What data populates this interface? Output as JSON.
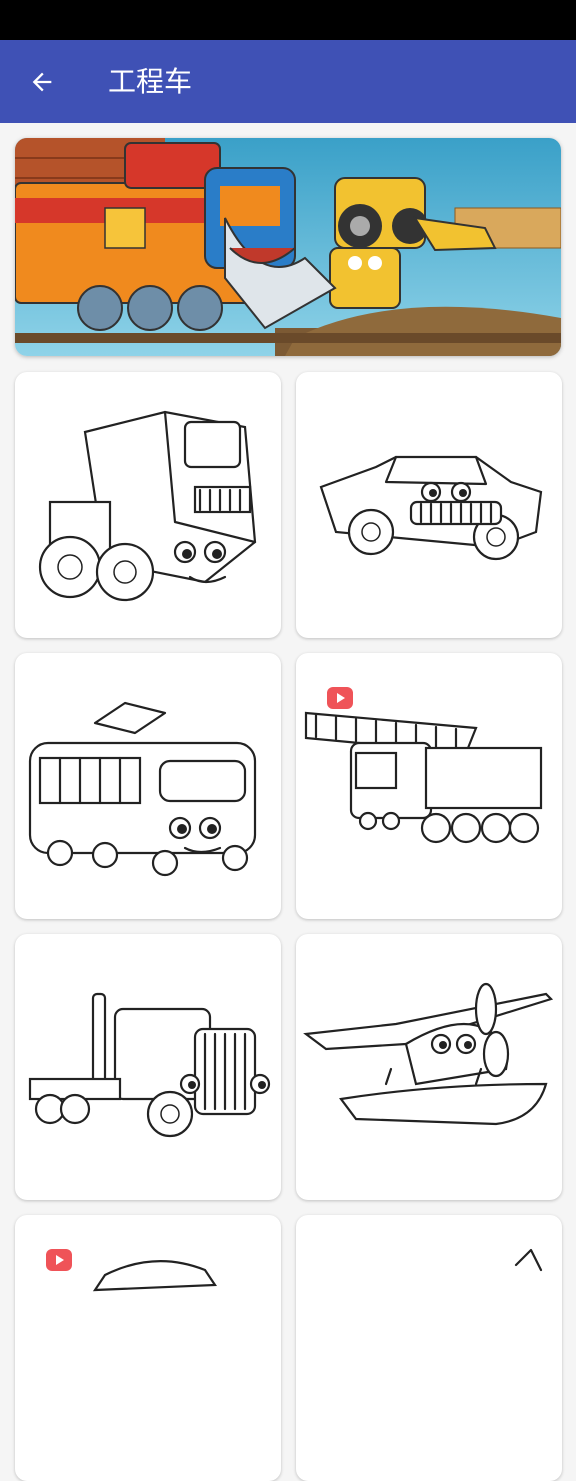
{
  "header": {
    "title": "工程车",
    "back_icon": "arrow-back-icon",
    "background": "#3f51b5"
  },
  "banner": {
    "description_icon": "cartoon-vehicles-banner"
  },
  "grid": {
    "items": [
      {
        "icon": "cartoon-truck-coloring",
        "locked_video": false
      },
      {
        "icon": "cartoon-vintage-car-coloring",
        "locked_video": false
      },
      {
        "icon": "cartoon-tram-coloring",
        "locked_video": false
      },
      {
        "icon": "cartoon-crane-truck-coloring",
        "locked_video": true
      },
      {
        "icon": "cartoon-semi-truck-coloring",
        "locked_video": false
      },
      {
        "icon": "cartoon-seaplane-coloring",
        "locked_video": false
      },
      {
        "icon": "cartoon-car-coloring",
        "locked_video": true
      },
      {
        "icon": "cartoon-vehicle-coloring",
        "locked_video": false
      }
    ],
    "badge_color": "#ef5358"
  }
}
